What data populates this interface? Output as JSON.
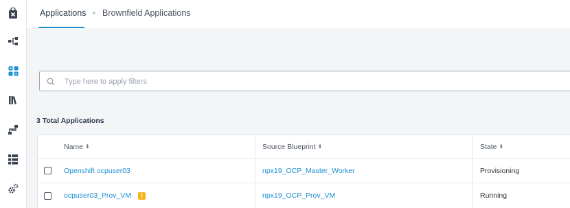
{
  "tabs": [
    {
      "label": "Applications",
      "active": true
    },
    {
      "label": "Brownfield Applications",
      "active": false
    }
  ],
  "sidebar": {
    "icons": [
      "marketplace-bag-icon",
      "topology-icon",
      "applications-grid-icon",
      "library-books-icon",
      "blueprint-flow-icon",
      "environments-stack-icon",
      "settings-gears-icon"
    ]
  },
  "filter": {
    "placeholder": "Type here to apply filters",
    "value": ""
  },
  "summary": {
    "total_label": "3 Total Applications"
  },
  "table": {
    "columns": [
      {
        "label": "Name",
        "sort": "⬍"
      },
      {
        "label": "Source Blueprint",
        "sort": "⬍"
      },
      {
        "label": "State",
        "sort": "⬍"
      }
    ],
    "rows": [
      {
        "name": "Openshift ocpuser03",
        "blueprint": "npx19_OCP_Master_Worker",
        "state": "Provisioning",
        "warning": false
      },
      {
        "name": "ocpuser03_Prov_VM",
        "blueprint": "npx19_OCP_Prov_VM",
        "state": "Running",
        "warning": true
      }
    ],
    "warning_glyph": "!"
  },
  "colors": {
    "accent": "#1b8fd2",
    "warning": "#f5b41c",
    "background": "#f4f5f7"
  }
}
